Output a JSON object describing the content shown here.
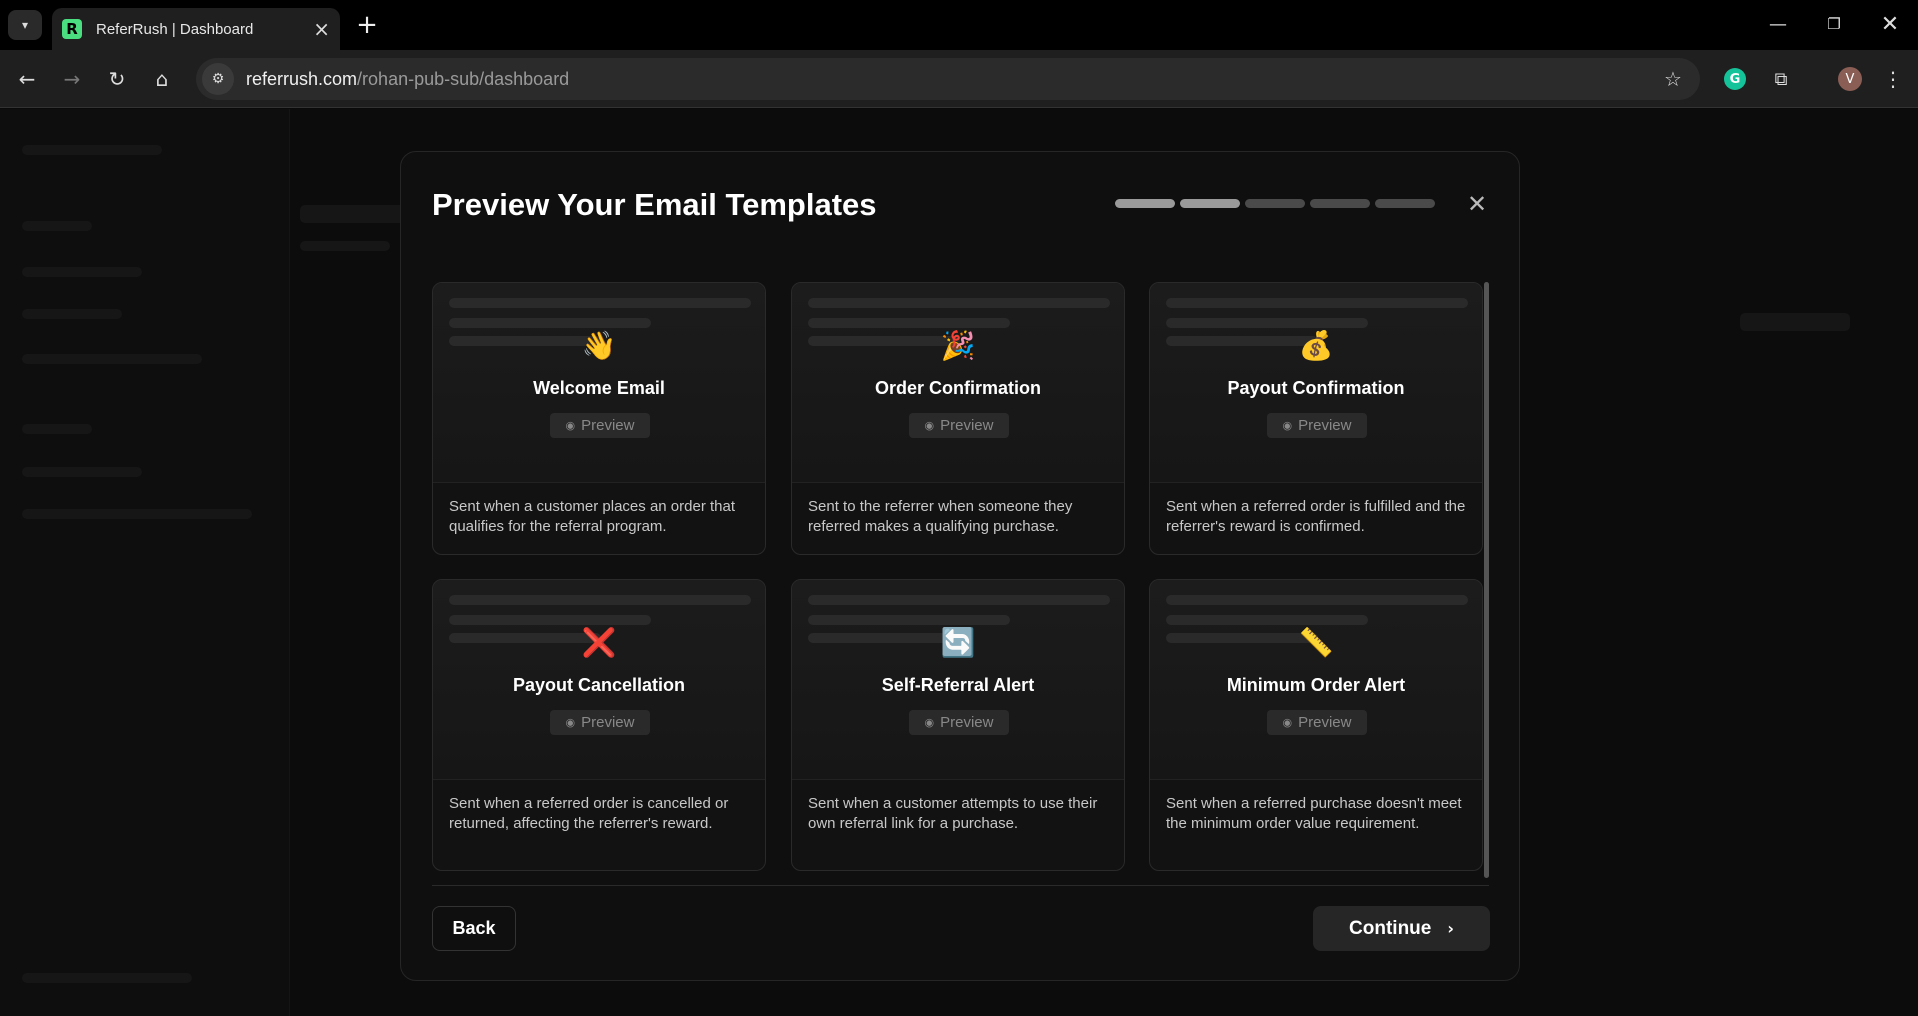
{
  "browser": {
    "tab_title": "ReferRush | Dashboard",
    "favicon_letter": "R",
    "url_host": "referrush.com",
    "url_path": "/rohan-pub-sub/dashboard",
    "profile_initial": "V"
  },
  "modal": {
    "title": "Preview Your Email Templates",
    "steps_total": 5,
    "steps_active": 2,
    "preview_label": "Preview",
    "back_label": "Back",
    "continue_label": "Continue",
    "templates": [
      {
        "emoji": "👋",
        "title": "Welcome Email",
        "description": "Sent when a customer places an order that qualifies for the referral program."
      },
      {
        "emoji": "🎉",
        "title": "Order Confirmation",
        "description": "Sent to the referrer when someone they referred makes a qualifying purchase."
      },
      {
        "emoji": "💰",
        "title": "Payout Confirmation",
        "description": "Sent when a referred order is fulfilled and the referrer's reward is confirmed."
      },
      {
        "emoji": "❌",
        "title": "Payout Cancellation",
        "description": "Sent when a referred order is cancelled or returned, affecting the referrer's reward."
      },
      {
        "emoji": "🔄",
        "title": "Self-Referral Alert",
        "description": "Sent when a customer attempts to use their own referral link for a purchase."
      },
      {
        "emoji": "📏",
        "title": "Minimum Order Alert",
        "description": "Sent when a referred purchase doesn't meet the minimum order value requirement."
      }
    ]
  }
}
